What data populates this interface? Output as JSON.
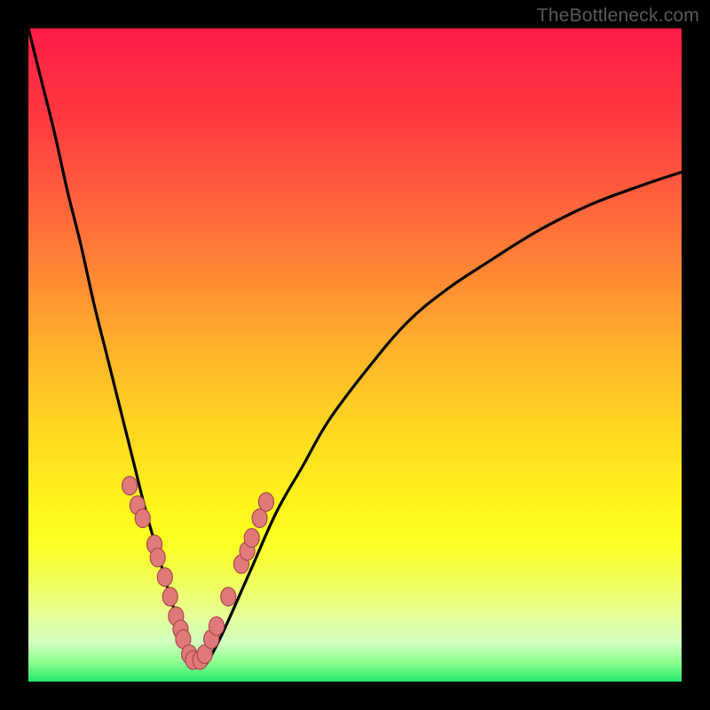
{
  "watermark": "TheBottleneck.com",
  "colors": {
    "frame": "#000000",
    "curve": "#000000",
    "marker_fill": "#e07a7a",
    "marker_stroke": "#a84a4a",
    "watermark_text": "#5a5a5a",
    "gradient_top": "#ff1a47",
    "gradient_bottom": "#22e86e"
  },
  "chart_data": {
    "type": "line",
    "title": "",
    "xlabel": "",
    "ylabel": "",
    "xlim": [
      0,
      100
    ],
    "ylim": [
      0,
      100
    ],
    "notes": "Bottleneck-style curve. X axis is a normalized comparison scale (0–100), Y axis is bottleneck % (0–100). Curve has its minimum around x≈25. No tick labels are rendered. Pink markers highlight the two flanks of the valley near the bottom; they lie roughly between y≈4 and y≈30. Background is a vertical rainbow gradient (red at top = high bottleneck, green at bottom = low).",
    "series": [
      {
        "name": "bottleneck-curve",
        "x": [
          0,
          2,
          4,
          6,
          8,
          10,
          12,
          14,
          16,
          18,
          20,
          22,
          24,
          25,
          26,
          27,
          28,
          30,
          34,
          38,
          42,
          46,
          52,
          58,
          64,
          70,
          78,
          86,
          94,
          100
        ],
        "y": [
          100,
          92,
          84,
          75,
          67,
          58,
          50,
          42,
          34,
          26,
          19,
          12,
          6,
          2.5,
          2.2,
          2.5,
          4,
          8,
          17,
          26,
          33,
          40,
          48,
          55,
          60,
          64,
          69,
          73,
          76,
          78
        ]
      }
    ],
    "markers": [
      {
        "x": 15.5,
        "y": 30
      },
      {
        "x": 16.7,
        "y": 27
      },
      {
        "x": 17.5,
        "y": 25
      },
      {
        "x": 19.3,
        "y": 21
      },
      {
        "x": 19.8,
        "y": 19
      },
      {
        "x": 20.9,
        "y": 16
      },
      {
        "x": 21.7,
        "y": 13
      },
      {
        "x": 22.6,
        "y": 10
      },
      {
        "x": 23.3,
        "y": 8
      },
      {
        "x": 23.7,
        "y": 6.5
      },
      {
        "x": 24.6,
        "y": 4.2
      },
      {
        "x": 25.2,
        "y": 3.3
      },
      {
        "x": 26.3,
        "y": 3.3
      },
      {
        "x": 27.0,
        "y": 4.2
      },
      {
        "x": 28.0,
        "y": 6.5
      },
      {
        "x": 28.8,
        "y": 8.5
      },
      {
        "x": 30.6,
        "y": 13
      },
      {
        "x": 32.6,
        "y": 18
      },
      {
        "x": 33.5,
        "y": 20
      },
      {
        "x": 34.2,
        "y": 22
      },
      {
        "x": 35.4,
        "y": 25
      },
      {
        "x": 36.4,
        "y": 27.5
      }
    ]
  }
}
